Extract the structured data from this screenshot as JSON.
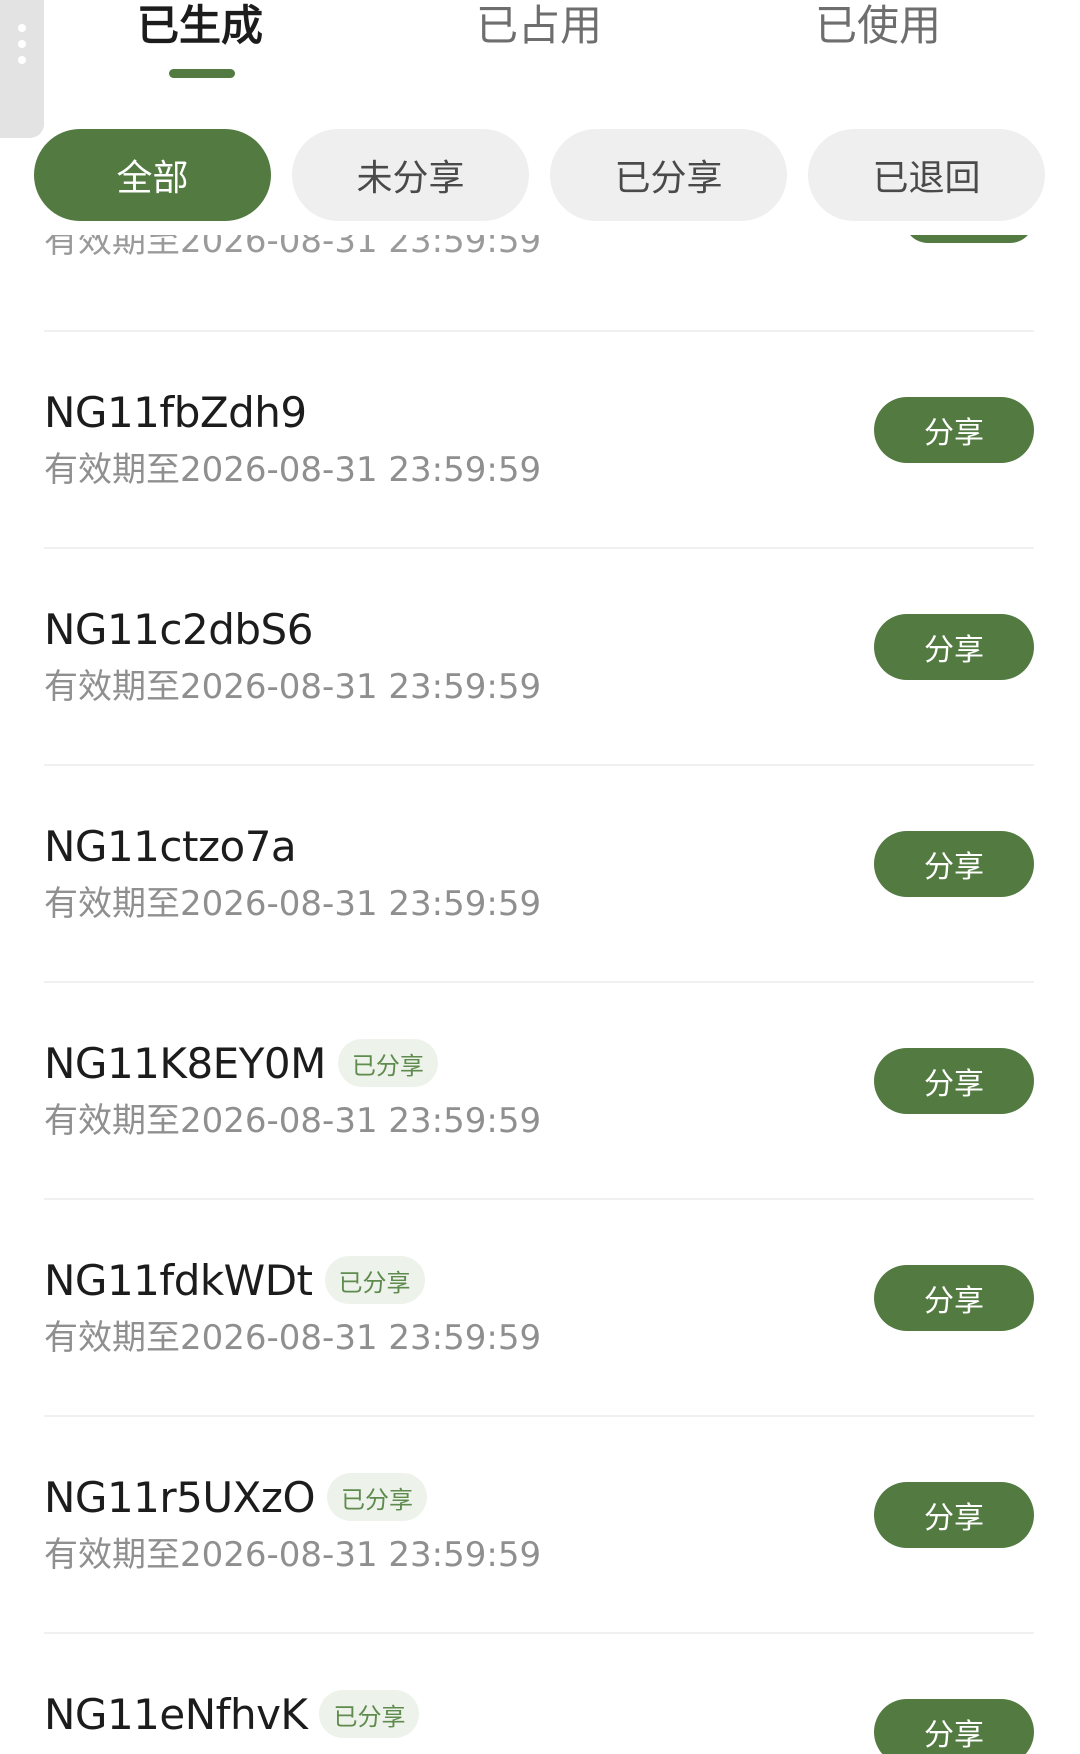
{
  "tabs": [
    {
      "label": "已生成",
      "active": true
    },
    {
      "label": "已占用",
      "active": false
    },
    {
      "label": "已使用",
      "active": false
    }
  ],
  "filters": [
    {
      "label": "全部",
      "active": true
    },
    {
      "label": "未分享",
      "active": false
    },
    {
      "label": "已分享",
      "active": false
    },
    {
      "label": "已退回",
      "active": false
    }
  ],
  "partial_item": {
    "expiry": "有效期至2026-08-31 23:59:59"
  },
  "items": [
    {
      "code": "NG11fbZdh9",
      "tag": "",
      "expiry": "有效期至2026-08-31 23:59:59",
      "button": "分享"
    },
    {
      "code": "NG11c2dbS6",
      "tag": "",
      "expiry": "有效期至2026-08-31 23:59:59",
      "button": "分享"
    },
    {
      "code": "NG11ctzo7a",
      "tag": "",
      "expiry": "有效期至2026-08-31 23:59:59",
      "button": "分享"
    },
    {
      "code": "NG11K8EY0M",
      "tag": "已分享",
      "expiry": "有效期至2026-08-31 23:59:59",
      "button": "分享"
    },
    {
      "code": "NG11fdkWDt",
      "tag": "已分享",
      "expiry": "有效期至2026-08-31 23:59:59",
      "button": "分享"
    },
    {
      "code": "NG11r5UXzO",
      "tag": "已分享",
      "expiry": "有效期至2026-08-31 23:59:59",
      "button": "分享"
    },
    {
      "code": "NG11eNfhvK",
      "tag": "已分享",
      "expiry": "",
      "button": "分享"
    }
  ],
  "colors": {
    "accent": "#527a41",
    "chip_bg": "#efefef",
    "tag_bg": "#edf2ea",
    "tag_text": "#5f8b4e",
    "muted_text": "#8f8f8f"
  }
}
